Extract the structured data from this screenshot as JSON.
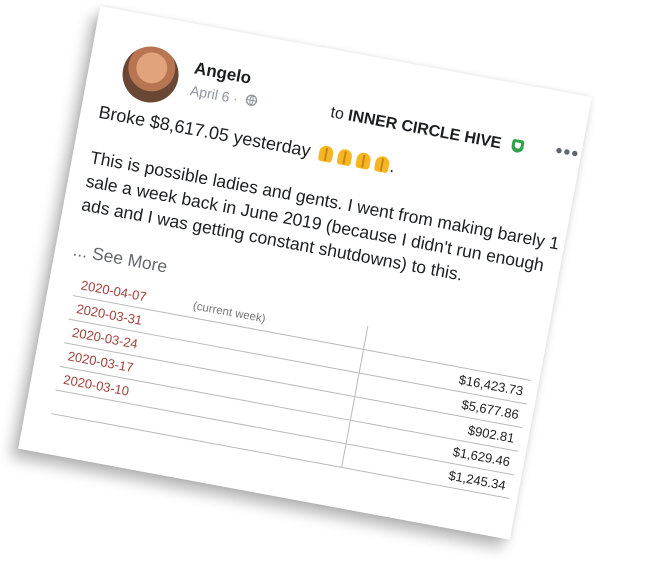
{
  "post": {
    "author": "Angelo",
    "date": "April 6",
    "to_prefix": "to",
    "group": "INNER CIRCLE HIVE",
    "headline": "Broke $8,617.05 yesterday",
    "headline_end": ".",
    "body": "This is possible ladies and gents. I went from making barely 1 sale a week back in June 2019 (because I didn't run enough ads and I was getting constant shutdowns) to this.",
    "see_more": "... See More",
    "more_options": "•••"
  },
  "icons": {
    "avatar": "profile-photo",
    "privacy": "globe-icon",
    "group_badge": "shield-icon",
    "menu": "more-options-icon",
    "emoji": "folded-hands-emoji"
  },
  "colors": {
    "text": "#1c1e21",
    "meta": "#8d949e",
    "badge": "#31a24c",
    "date_text": "#a0433a"
  },
  "table": {
    "rows": [
      {
        "date": "2020-04-07",
        "note": "(current week)",
        "amount": ""
      },
      {
        "date": "2020-03-31",
        "note": "",
        "amount": "$16,423.73"
      },
      {
        "date": "2020-03-24",
        "note": "",
        "amount": "$5,677.86"
      },
      {
        "date": "2020-03-17",
        "note": "",
        "amount": "$902.81"
      },
      {
        "date": "2020-03-10",
        "note": "",
        "amount": "$1,629.46"
      },
      {
        "date": "",
        "note": "",
        "amount": "$1,245.34"
      }
    ]
  }
}
